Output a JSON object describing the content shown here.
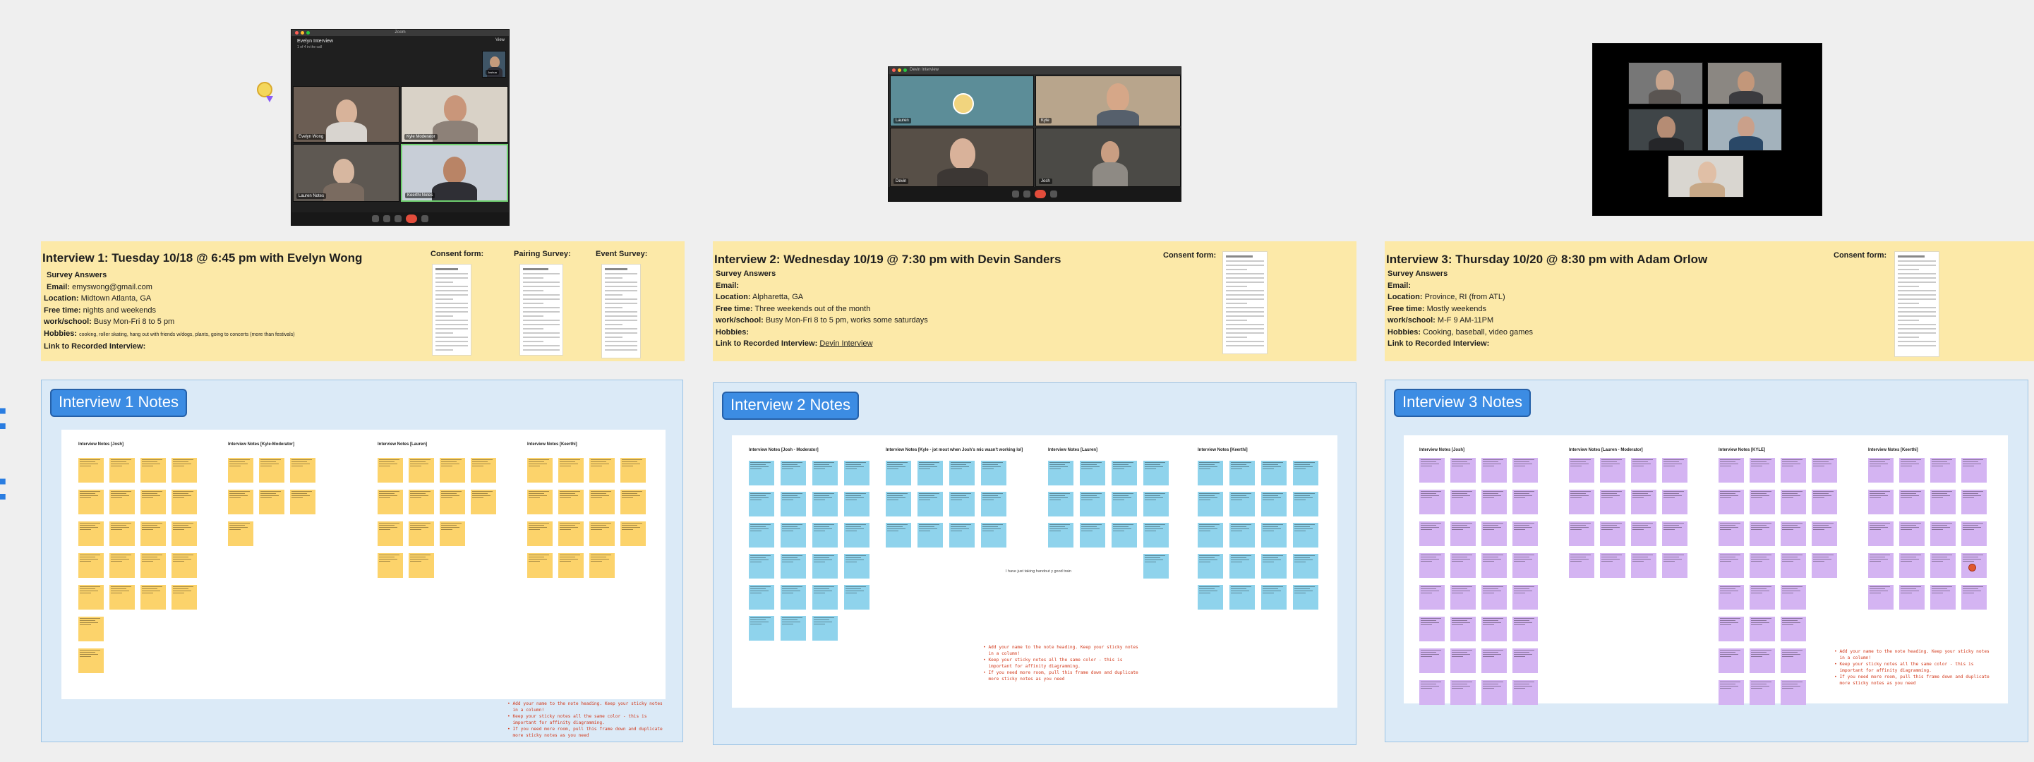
{
  "canvas": {
    "background": "#efefef"
  },
  "edge_glyphs": [
    ":",
    ":"
  ],
  "cursor": {
    "icon": "collaborator-avatar-icon"
  },
  "videos": [
    {
      "window_title": "Zoom",
      "host_name": "Evelyn Interview",
      "host_sub": "1 of 4 in the call",
      "view_label": "View",
      "participants": [
        "Evelyn Wong",
        "Kyle Moderator",
        "Lauren Notes",
        "Keerthi Notes",
        "Joshua"
      ]
    },
    {
      "window_title": "",
      "host_name": "Devin Interview",
      "participants": [
        "Lauren",
        "Kyle",
        "Devin",
        "Josh"
      ]
    },
    {
      "window_title": "",
      "participants": [
        "",
        "",
        "",
        "",
        ""
      ]
    }
  ],
  "surveys": [
    {
      "title": "Interview 1: Tuesday 10/18 @ 6:45 pm with Evelyn Wong",
      "section": "Survey Answers",
      "email_label": "Email:",
      "email": "emyswong@gmail.com",
      "location_label": "Location:",
      "location": "Midtown Atlanta, GA",
      "free_label": "Free time:",
      "free": "nights and weekends",
      "work_label": "work/school:",
      "work": "Busy Mon-Fri 8 to 5 pm",
      "hobbies_label": "Hobbies:",
      "hobbies": "cooking, roller skating, hang out with friends w/dogs, plants, going to concerts (more than festivals)",
      "link_label": "Link to Recorded Interview:",
      "link": "",
      "docs": [
        "Consent form:",
        "Pairing Survey:",
        "Event Survey:"
      ]
    },
    {
      "title": "Interview 2: Wednesday 10/19 @ 7:30 pm with Devin Sanders",
      "section": "Survey Answers",
      "email_label": "Email:",
      "email": "",
      "location_label": "Location:",
      "location": "Alpharetta, GA",
      "free_label": "Free time:",
      "free": "Three weekends out of the month",
      "work_label": "work/school:",
      "work": "Busy Mon-Fri 8 to 5 pm, works some saturdays",
      "hobbies_label": "Hobbies:",
      "hobbies": "",
      "link_label": "Link to Recorded Interview:",
      "link": "Devin Interview",
      "docs": [
        "Consent form:"
      ]
    },
    {
      "title": "Interview 3: Thursday 10/20 @ 8:30 pm with Adam Orlow",
      "section": "Survey Answers",
      "email_label": "Email:",
      "email": "",
      "location_label": "Location:",
      "location": "Province, RI (from ATL)",
      "free_label": "Free time:",
      "free": "Mostly weekends",
      "work_label": "work/school:",
      "work": "M-F  9 AM-11PM",
      "hobbies_label": "Hobbies:",
      "hobbies": "Cooking, baseball, video games",
      "link_label": "Link to Recorded Interview:",
      "link": "",
      "docs": [
        "Consent form:"
      ]
    }
  ],
  "notes": [
    {
      "tag": "Interview 1 Notes",
      "sticky_color": "#fcd36b",
      "columns": [
        "Interview Notes [Josh]",
        "Interview Notes [Kyle-Moderator]",
        "Interview Notes [Lauren]",
        "Interview Notes [Keerthi]"
      ],
      "instructions": "• Add your name to the note heading. Keep your sticky notes\n  in a column!\n• Keep your sticky notes all the same color - this is\n  important for affinity diagramming.\n• If you need more room, pull this frame down and duplicate\n  more sticky notes as you need",
      "center_note": ""
    },
    {
      "tag": "Interview 2 Notes",
      "sticky_color": "#8fd3ec",
      "columns": [
        "Interview Notes [Josh - Moderator]",
        "Interview Notes [Kyle - jot most when Josh's mic wasn't working lol]",
        "Interview Notes [Lauren]",
        "Interview Notes [Keerthi]"
      ],
      "instructions": "• Add your name to the note heading. Keep your sticky notes\n  in a column!\n• Keep your sticky notes all the same color - this is\n  important for affinity diagramming.\n• If you need more room, pull this frame down and duplicate\n  more sticky notes as you need",
      "center_note": "I have just taking handout y good train"
    },
    {
      "tag": "Interview 3 Notes",
      "sticky_color": "#d4b4f2",
      "columns": [
        "Interview Notes [Josh]",
        "Interview Notes [Lauren - Moderator]",
        "Interview Notes [KYLE]",
        "Interview Notes [Keerthi]"
      ],
      "instructions": "• Add your name to the note heading. Keep your sticky notes\n  in a column!\n• Keep your sticky notes all the same color - this is\n  important for affinity diagramming.\n• If you need more room, pull this frame down and duplicate\n  more sticky notes as you need",
      "center_note": ""
    }
  ]
}
